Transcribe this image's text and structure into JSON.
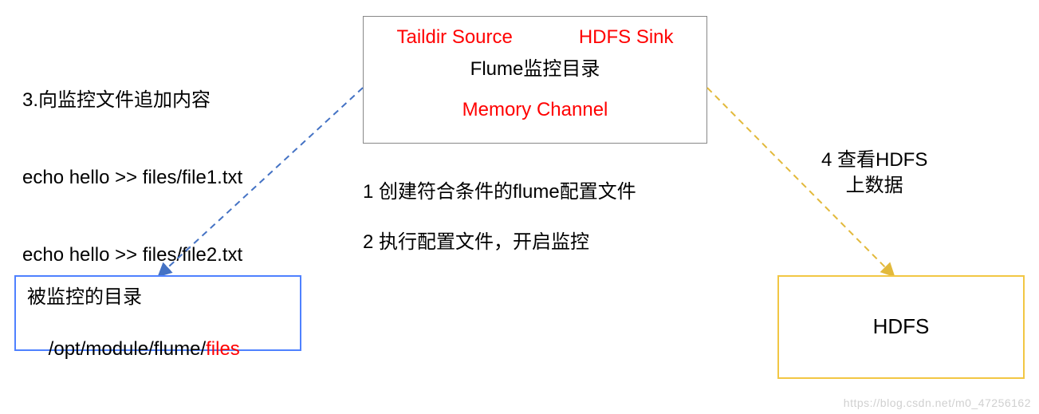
{
  "step3": {
    "title": "3.向监控文件追加内容",
    "cmd1": "echo hello >> files/file1.txt",
    "cmd2": "echo hello >> files/file2.txt"
  },
  "flume_box": {
    "source": "Taildir Source",
    "sink": "HDFS Sink",
    "title": "Flume监控目录",
    "channel": "Memory Channel"
  },
  "steps": {
    "s1": "1 创建符合条件的flume配置文件",
    "s2": "2 执行配置文件，开启监控",
    "s4_line1": "4 查看HDFS",
    "s4_line2": "上数据"
  },
  "monitored": {
    "title": "被监控的目录",
    "path_prefix": "/opt/module/flume/",
    "path_highlight": "files"
  },
  "hdfs": {
    "label": "HDFS"
  },
  "colors": {
    "red": "#ff0000",
    "blue_border": "#4f81ff",
    "yellow_border": "#f2c744",
    "arrow_blue": "#4472c4",
    "arrow_yellow": "#ed7d31"
  },
  "watermark": "https://blog.csdn.net/m0_47256162"
}
